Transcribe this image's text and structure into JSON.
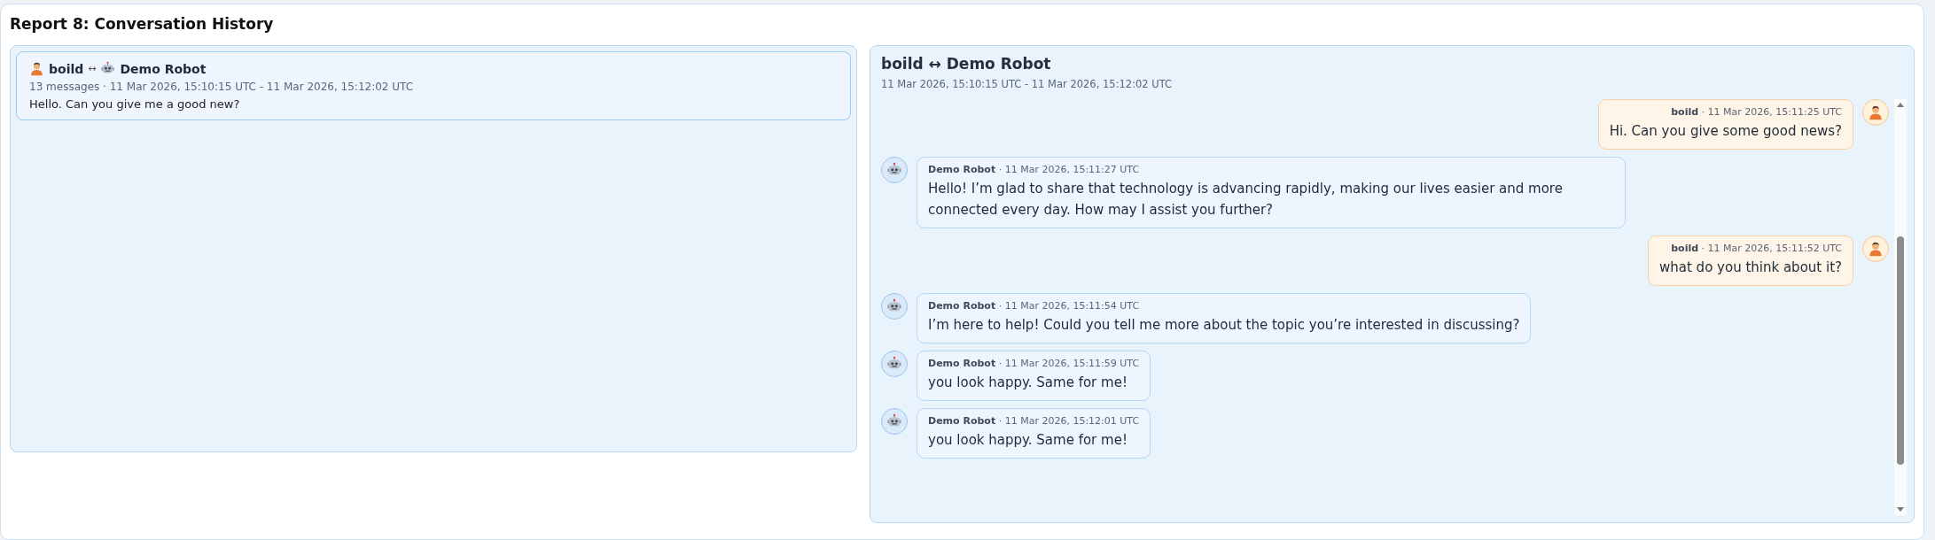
{
  "page": {
    "title": "Report 8: Conversation History"
  },
  "conversations": [
    {
      "user": "boild",
      "separator": "↔",
      "bot": "Demo Robot",
      "meta": "13 messages · 11 Mar 2026, 15:10:15 UTC - 11 Mar 2026, 15:12:02 UTC",
      "preview": "Hello. Can you give me a good new?",
      "selected": true
    }
  ],
  "detail": {
    "title": "boild ↔ Demo Robot",
    "range": "11 Mar 2026, 15:10:15 UTC - 11 Mar 2026, 15:12:02 UTC",
    "messages": [
      {
        "kind": "user",
        "sender": "boild",
        "time": "· 11 Mar 2026, 15:11:25 UTC",
        "text": "Hi. Can you give some good news?"
      },
      {
        "kind": "bot",
        "sender": "Demo Robot",
        "time": "· 11 Mar 2026, 15:11:27 UTC",
        "text": "Hello! I’m glad to share that technology is advancing rapidly, making our lives easier and more connected every day. How may I assist you further?"
      },
      {
        "kind": "user",
        "sender": "boild",
        "time": "· 11 Mar 2026, 15:11:52 UTC",
        "text": "what do you think about it?"
      },
      {
        "kind": "bot",
        "sender": "Demo Robot",
        "time": "· 11 Mar 2026, 15:11:54 UTC",
        "text": "I’m here to help! Could you tell me more about the topic you’re interested in discussing?"
      },
      {
        "kind": "bot",
        "sender": "Demo Robot",
        "time": "· 11 Mar 2026, 15:11:59 UTC",
        "text": "you look happy. Same for me!"
      },
      {
        "kind": "bot",
        "sender": "Demo Robot",
        "time": "· 11 Mar 2026, 15:12:01 UTC",
        "text": "you look happy. Same for me!"
      }
    ]
  }
}
